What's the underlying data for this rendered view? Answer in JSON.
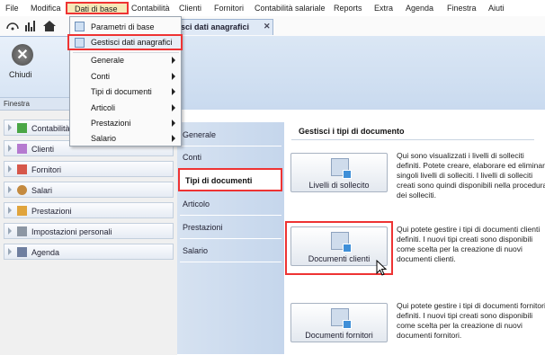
{
  "menubar": {
    "items": [
      {
        "label": "File"
      },
      {
        "label": "Modifica"
      },
      {
        "label": "Dati di base"
      },
      {
        "label": "Contabilità"
      },
      {
        "label": "Clienti"
      },
      {
        "label": "Fornitori"
      },
      {
        "label": "Contabilità salariale"
      },
      {
        "label": "Reports"
      },
      {
        "label": "Extra"
      },
      {
        "label": "Agenda"
      },
      {
        "label": "Finestra"
      },
      {
        "label": "Aiuti"
      }
    ]
  },
  "document_tab": {
    "label": "sci dati anagrafici",
    "close": "✕"
  },
  "ribbon": {
    "close_label": "Chiudi",
    "group_label": "Finestra"
  },
  "dropdown": {
    "items": [
      {
        "label": "Parametri di base"
      },
      {
        "label": "Gestisci dati anagrafici"
      },
      {
        "label": "Generale"
      },
      {
        "label": "Conti"
      },
      {
        "label": "Tipi di documenti"
      },
      {
        "label": "Articoli"
      },
      {
        "label": "Prestazioni"
      },
      {
        "label": "Salario"
      }
    ]
  },
  "nav": {
    "items": [
      {
        "label": "Contabilità"
      },
      {
        "label": "Clienti"
      },
      {
        "label": "Fornitori"
      },
      {
        "label": "Salari"
      },
      {
        "label": "Prestazioni"
      },
      {
        "label": "Impostazioni personali"
      },
      {
        "label": "Agenda"
      }
    ]
  },
  "categories": {
    "items": [
      {
        "label": "Generale"
      },
      {
        "label": "Conti"
      },
      {
        "label": "Tipi di documenti"
      },
      {
        "label": "Articolo"
      },
      {
        "label": "Prestazioni"
      },
      {
        "label": "Salario"
      }
    ]
  },
  "content": {
    "title": "Gestisci i tipi di documento",
    "buttons": [
      {
        "label": "Livelli di sollecito",
        "description": "Qui sono visualizzati i livelli di solleciti definiti. Potete creare, elaborare ed eliminare singoli livelli di solleciti. I livelli di solleciti creati sono quindi disponibili nella procedura dei solleciti."
      },
      {
        "label": "Documenti clienti",
        "description": "Qui potete gestire i tipi di documenti clienti definiti. I nuovi tipi creati sono disponibili come scelta per la creazione di nuovi documenti clienti."
      },
      {
        "label": "Documenti fornitori",
        "description": "Qui potete gestire i tipi di documenti fornitori definiti. I nuovi tipi creati sono disponibili come scelta per la creazione di nuovi documenti fornitori."
      }
    ]
  },
  "colors": {
    "highlight": "#e33333",
    "ribbon": "#d4e2f3",
    "panel": "#c5d6ec"
  }
}
